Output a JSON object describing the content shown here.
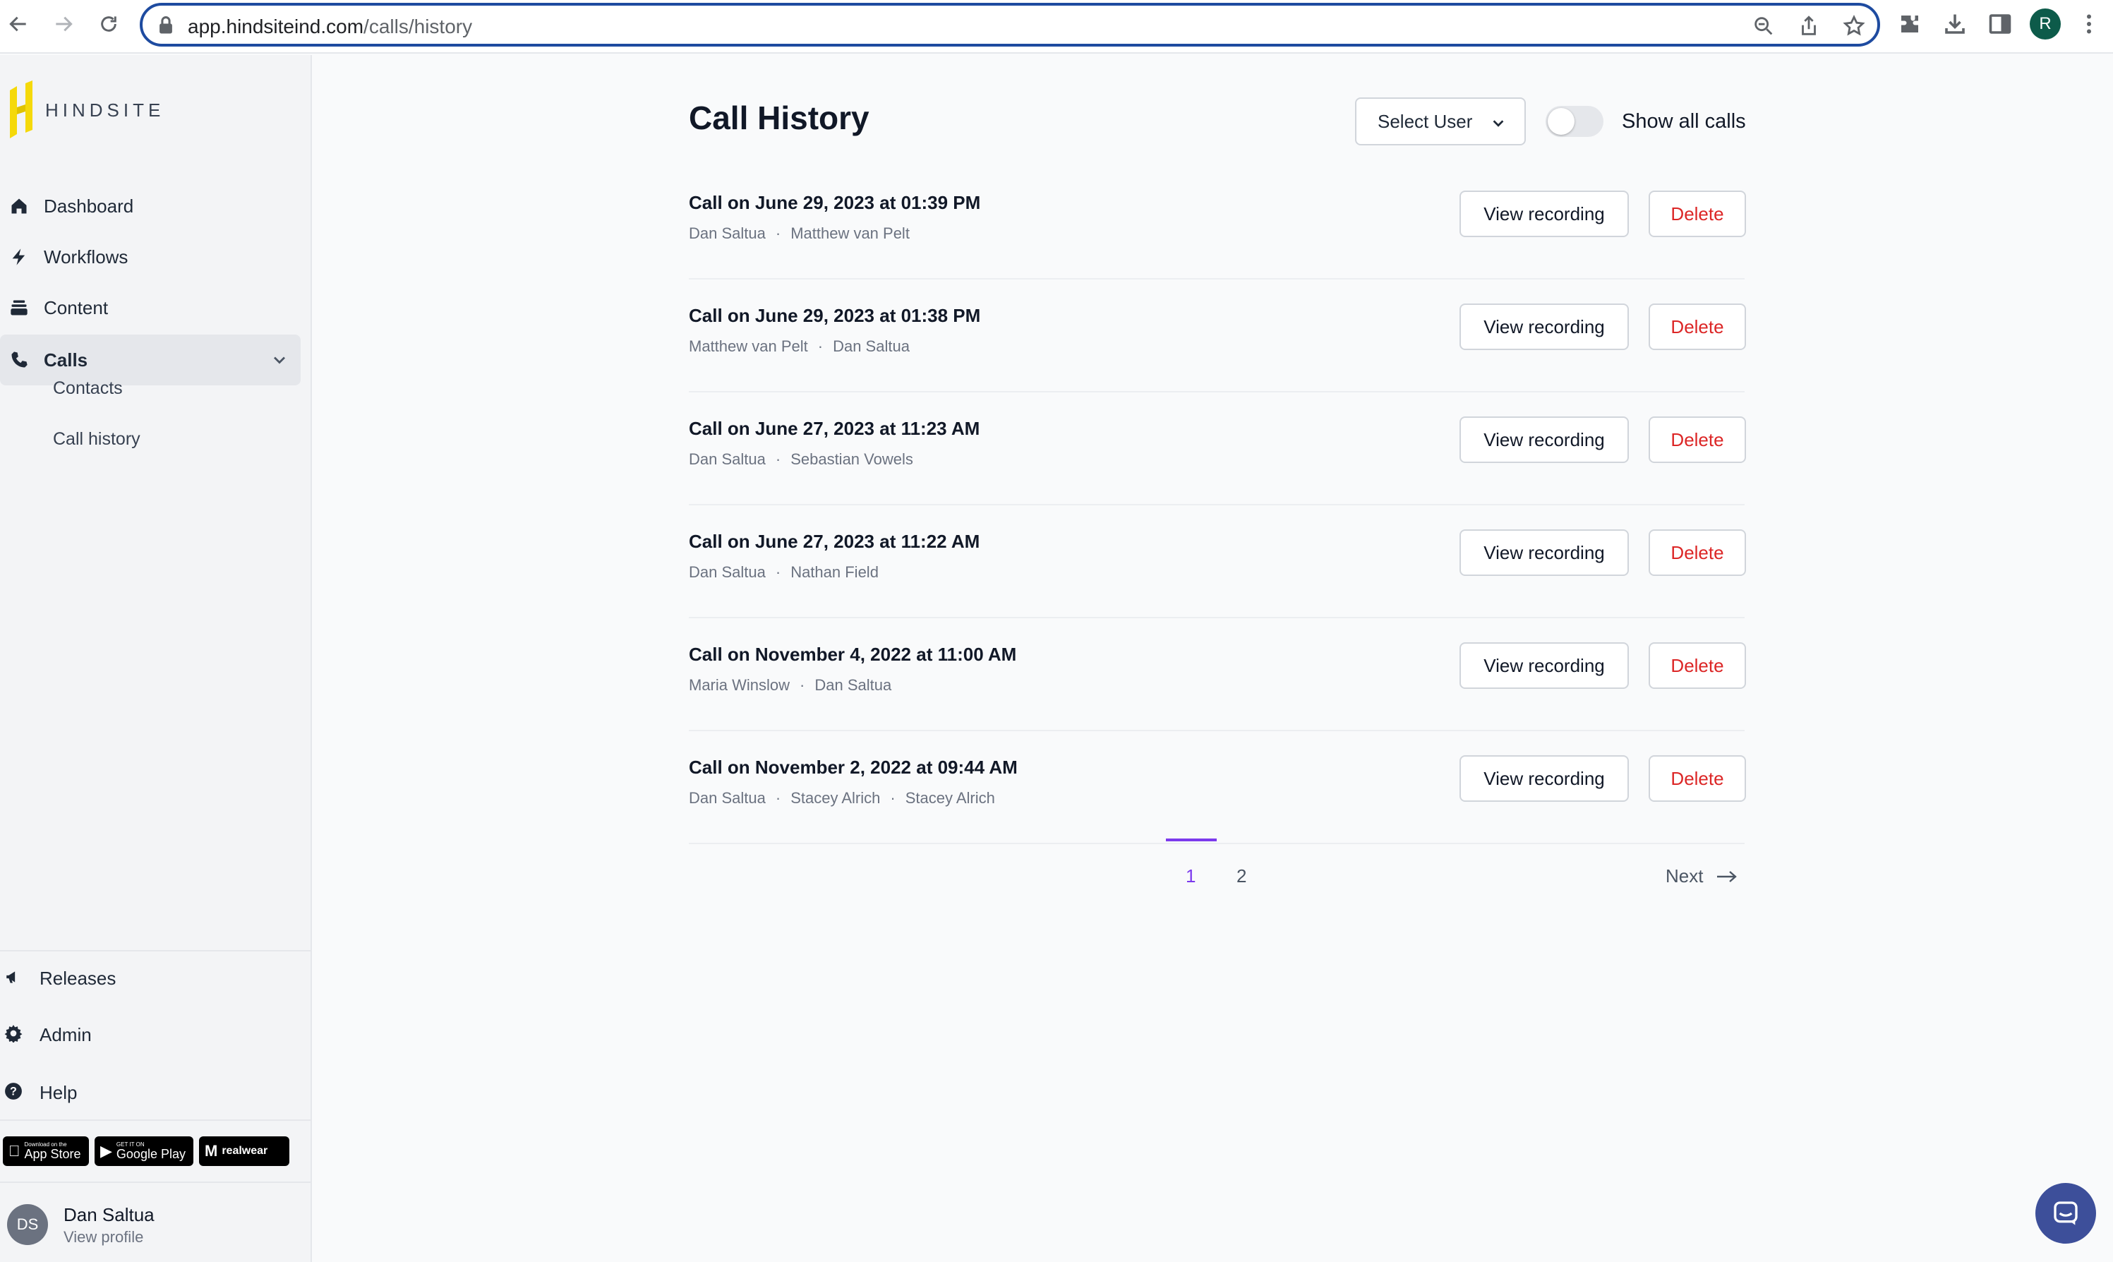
{
  "browser": {
    "url_host": "app.hindsiteind.com",
    "url_path": "/calls/history",
    "profile_initial": "R"
  },
  "sidebar": {
    "logo_text": "HINDSITE",
    "nav": [
      {
        "label": "Dashboard",
        "icon": "home-icon"
      },
      {
        "label": "Workflows",
        "icon": "bolt-icon"
      },
      {
        "label": "Content",
        "icon": "stack-icon"
      },
      {
        "label": "Calls",
        "icon": "phone-icon",
        "active": true
      }
    ],
    "sub_items": [
      {
        "label": "Contacts"
      },
      {
        "label": "Call history"
      }
    ],
    "bottom": [
      {
        "label": "Releases",
        "icon": "megaphone-icon"
      },
      {
        "label": "Admin",
        "icon": "gear-icon"
      },
      {
        "label": "Help",
        "icon": "question-icon"
      }
    ],
    "badges": {
      "app_store": "App Store",
      "app_store_small": "Download on the",
      "google_play": "Google Play",
      "google_play_small": "GET IT ON",
      "realwear": "realwear"
    },
    "user": {
      "initials": "DS",
      "name": "Dan Saltua",
      "link": "View profile"
    }
  },
  "main": {
    "title": "Call History",
    "select_user": "Select User",
    "toggle_label": "Show all calls",
    "toggle_on": false,
    "calls": [
      {
        "title": "Call on June 29, 2023 at 01:39 PM",
        "participants": [
          "Dan Saltua",
          "Matthew van Pelt"
        ],
        "view": "View recording",
        "delete": "Delete"
      },
      {
        "title": "Call on June 29, 2023 at 01:38 PM",
        "participants": [
          "Matthew van Pelt",
          "Dan Saltua"
        ],
        "view": "View recording",
        "delete": "Delete"
      },
      {
        "title": "Call on June 27, 2023 at 11:23 AM",
        "participants": [
          "Dan Saltua",
          "Sebastian Vowels"
        ],
        "view": "View recording",
        "delete": "Delete"
      },
      {
        "title": "Call on June 27, 2023 at 11:22 AM",
        "participants": [
          "Dan Saltua",
          "Nathan Field"
        ],
        "view": "View recording",
        "delete": "Delete"
      },
      {
        "title": "Call on November 4, 2022 at 11:00 AM",
        "participants": [
          "Maria Winslow",
          "Dan Saltua"
        ],
        "view": "View recording",
        "delete": "Delete"
      },
      {
        "title": "Call on November 2, 2022 at 09:44 AM",
        "participants": [
          "Dan Saltua",
          "Stacey Alrich",
          "Stacey Alrich"
        ],
        "view": "View recording",
        "delete": "Delete"
      }
    ],
    "pagination": {
      "current": "1",
      "other": "2",
      "next": "Next"
    }
  },
  "colors": {
    "accent": "#7c3aed",
    "danger": "#dc2626",
    "logo_yellow": "#f5d90a",
    "chat": "#3d4f9a"
  }
}
